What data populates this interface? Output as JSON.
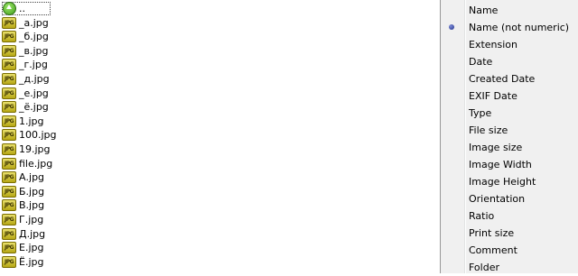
{
  "file_list": {
    "items": [
      {
        "name": "..",
        "type": "parent"
      },
      {
        "name": "_a.jpg",
        "type": "jpg"
      },
      {
        "name": "_б.jpg",
        "type": "jpg"
      },
      {
        "name": "_в.jpg",
        "type": "jpg"
      },
      {
        "name": "_г.jpg",
        "type": "jpg"
      },
      {
        "name": "_д.jpg",
        "type": "jpg"
      },
      {
        "name": "_е.jpg",
        "type": "jpg"
      },
      {
        "name": "_ё.jpg",
        "type": "jpg"
      },
      {
        "name": "1.jpg",
        "type": "jpg"
      },
      {
        "name": "100.jpg",
        "type": "jpg"
      },
      {
        "name": "19.jpg",
        "type": "jpg"
      },
      {
        "name": "file.jpg",
        "type": "jpg"
      },
      {
        "name": "А.jpg",
        "type": "jpg"
      },
      {
        "name": "Б.jpg",
        "type": "jpg"
      },
      {
        "name": "В.jpg",
        "type": "jpg"
      },
      {
        "name": "Г.jpg",
        "type": "jpg"
      },
      {
        "name": "Д.jpg",
        "type": "jpg"
      },
      {
        "name": "Е.jpg",
        "type": "jpg"
      },
      {
        "name": "Ё.jpg",
        "type": "jpg"
      }
    ],
    "jpg_icon_text": "JPG",
    "icons": {
      "parent": "up-arrow-icon",
      "jpg": "jpg-file-icon"
    }
  },
  "sort_menu": {
    "items": [
      {
        "label": "Name",
        "selected": false
      },
      {
        "label": "Name (not numeric)",
        "selected": true
      },
      {
        "label": "Extension",
        "selected": false
      },
      {
        "label": "Date",
        "selected": false
      },
      {
        "label": "Created Date",
        "selected": false
      },
      {
        "label": "EXIF Date",
        "selected": false
      },
      {
        "label": "Type",
        "selected": false
      },
      {
        "label": "File size",
        "selected": false
      },
      {
        "label": "Image size",
        "selected": false
      },
      {
        "label": "Image Width",
        "selected": false
      },
      {
        "label": "Image Height",
        "selected": false
      },
      {
        "label": "Orientation",
        "selected": false
      },
      {
        "label": "Ratio",
        "selected": false
      },
      {
        "label": "Print size",
        "selected": false
      },
      {
        "label": "Comment",
        "selected": false
      },
      {
        "label": "Folder",
        "selected": false
      }
    ]
  }
}
